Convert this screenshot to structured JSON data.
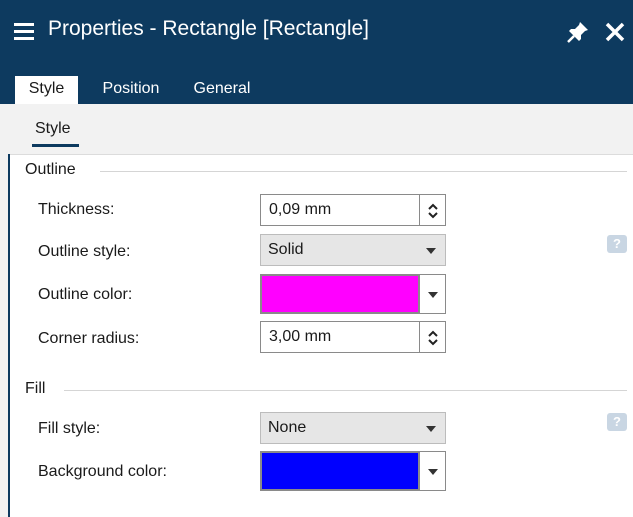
{
  "window": {
    "title": "Properties - Rectangle [Rectangle]"
  },
  "tabs": [
    {
      "label": "Style",
      "active": true
    },
    {
      "label": "Position",
      "active": false
    },
    {
      "label": "General",
      "active": false
    }
  ],
  "subtab": {
    "label": "Style"
  },
  "outline": {
    "title": "Outline",
    "thickness": {
      "label": "Thickness:",
      "value": "0,09 mm"
    },
    "style": {
      "label": "Outline style:",
      "value": "Solid"
    },
    "color": {
      "label": "Outline color:",
      "value": "#ff00ff"
    },
    "corner_radius": {
      "label": "Corner radius:",
      "value": "3,00 mm"
    }
  },
  "fill": {
    "title": "Fill",
    "style": {
      "label": "Fill style:",
      "value": "None"
    },
    "background": {
      "label": "Background color:",
      "value": "#0000ff"
    }
  },
  "help": {
    "glyph": "?"
  },
  "colors": {
    "titlebar": "#0d3a5f",
    "accent": "#0d3a5f",
    "help": "#c9d6e3"
  }
}
